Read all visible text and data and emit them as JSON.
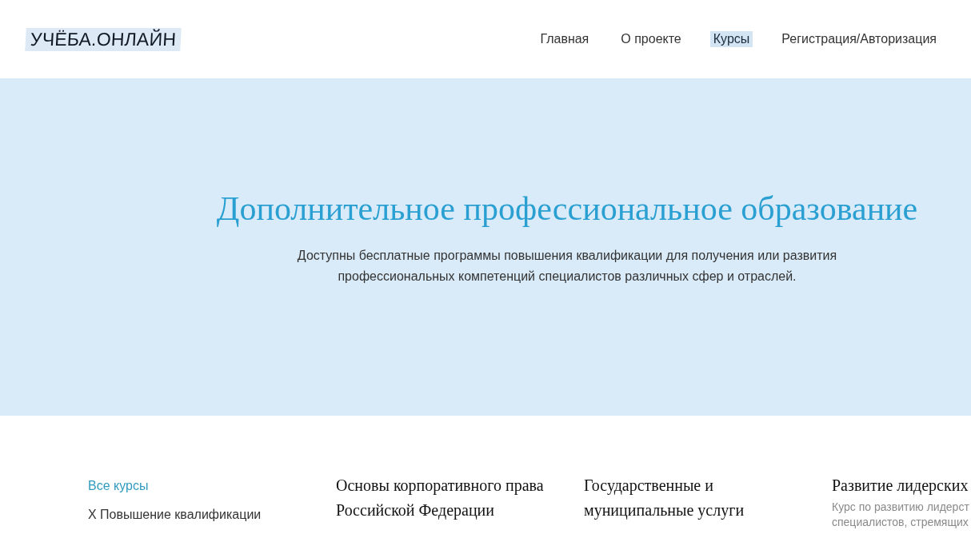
{
  "header": {
    "logo": "УЧЁБА.ОНЛАЙН",
    "nav": [
      {
        "label": "Главная",
        "selected": false
      },
      {
        "label": "О проекте",
        "selected": false
      },
      {
        "label": "Курсы",
        "selected": true
      },
      {
        "label": "Регистрация/Авторизация",
        "selected": false
      }
    ]
  },
  "hero": {
    "title": "Дополнительное профессиональное образование",
    "description": "Доступны бесплатные программы повышения квалификации для получения или развития профессиональных компетенций специалистов различных сфер и отраслей."
  },
  "sidebar": {
    "items": [
      {
        "kind": "link",
        "label": "Все курсы"
      },
      {
        "kind": "filter",
        "label": "X Повышение квалификации"
      }
    ]
  },
  "courses": [
    {
      "title": "Основы корпоративного права Российской Федерации"
    },
    {
      "title": "Государственные и муниципальные услуги"
    },
    {
      "title": "Развитие лидерских",
      "description_lines": [
        "Курс по развитию лидерст",
        "специалистов, стремящих"
      ]
    }
  ]
}
